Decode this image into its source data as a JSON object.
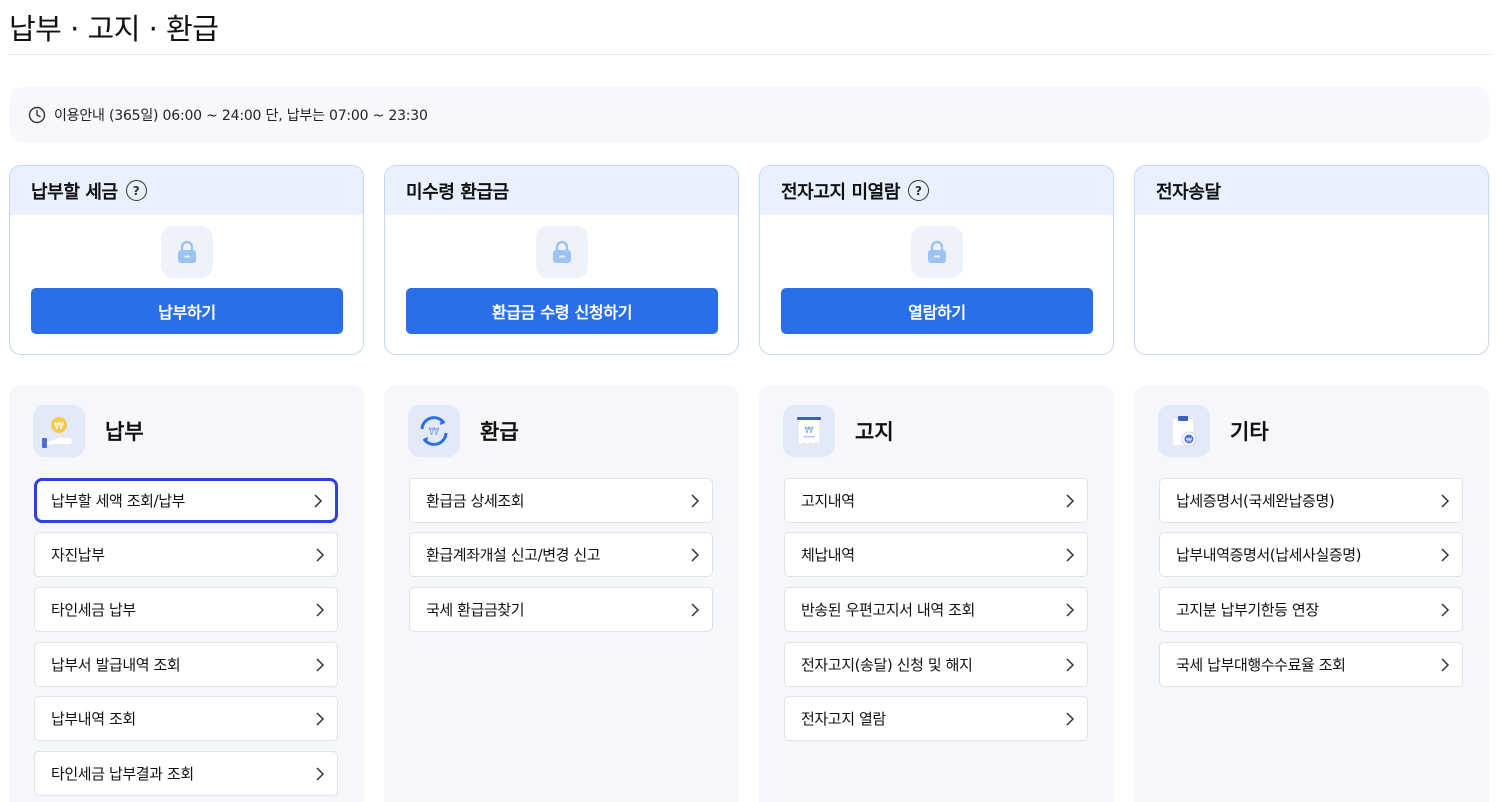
{
  "page": {
    "title": "납부 · 고지 · 환급"
  },
  "notice": {
    "icon": "clock-icon",
    "text": "이용안내 (365일) 06:00 ~ 24:00 단, 납부는 07:00 ~ 23:30"
  },
  "summary_cards": [
    {
      "title": "납부할 세금",
      "has_help": true,
      "icon": "lock-icon",
      "button": "납부하기"
    },
    {
      "title": "미수령 환급금",
      "has_help": false,
      "icon": "lock-icon",
      "button": "환급금 수령 신청하기"
    },
    {
      "title": "전자고지 미열람",
      "has_help": true,
      "icon": "lock-icon",
      "button": "열람하기"
    },
    {
      "title": "전자송달",
      "has_help": false
    }
  ],
  "help_glyph": "?",
  "panels": [
    {
      "title": "납부",
      "icon": "coin-hand-icon",
      "items": [
        "납부할 세액 조회/납부",
        "자진납부",
        "타인세금 납부",
        "납부서 발급내역 조회",
        "납부내역 조회",
        "타인세금 납부결과 조회"
      ]
    },
    {
      "title": "환급",
      "icon": "refund-cycle-icon",
      "items": [
        "환급금 상세조회",
        "환급계좌개설 신고/변경 신고",
        "국세 환급금찾기"
      ]
    },
    {
      "title": "고지",
      "icon": "notice-receipt-icon",
      "items": [
        "고지내역",
        "체납내역",
        "반송된 우편고지서 내역 조회",
        "전자고지(송달) 신청 및 해지",
        "전자고지 열람"
      ]
    },
    {
      "title": "기타",
      "icon": "clipboard-coin-icon",
      "items": [
        "납세증명서(국세완납증명)",
        "납부내역증명서(납세사실증명)",
        "고지분 납부기한등 연장",
        "국세 납부대행수수료율 조회"
      ]
    }
  ],
  "colors": {
    "primary": "#2a6fe8",
    "card_header": "#e9f1fe",
    "panel_bg": "#f5f7fb",
    "focus": "#2f3fe0"
  }
}
